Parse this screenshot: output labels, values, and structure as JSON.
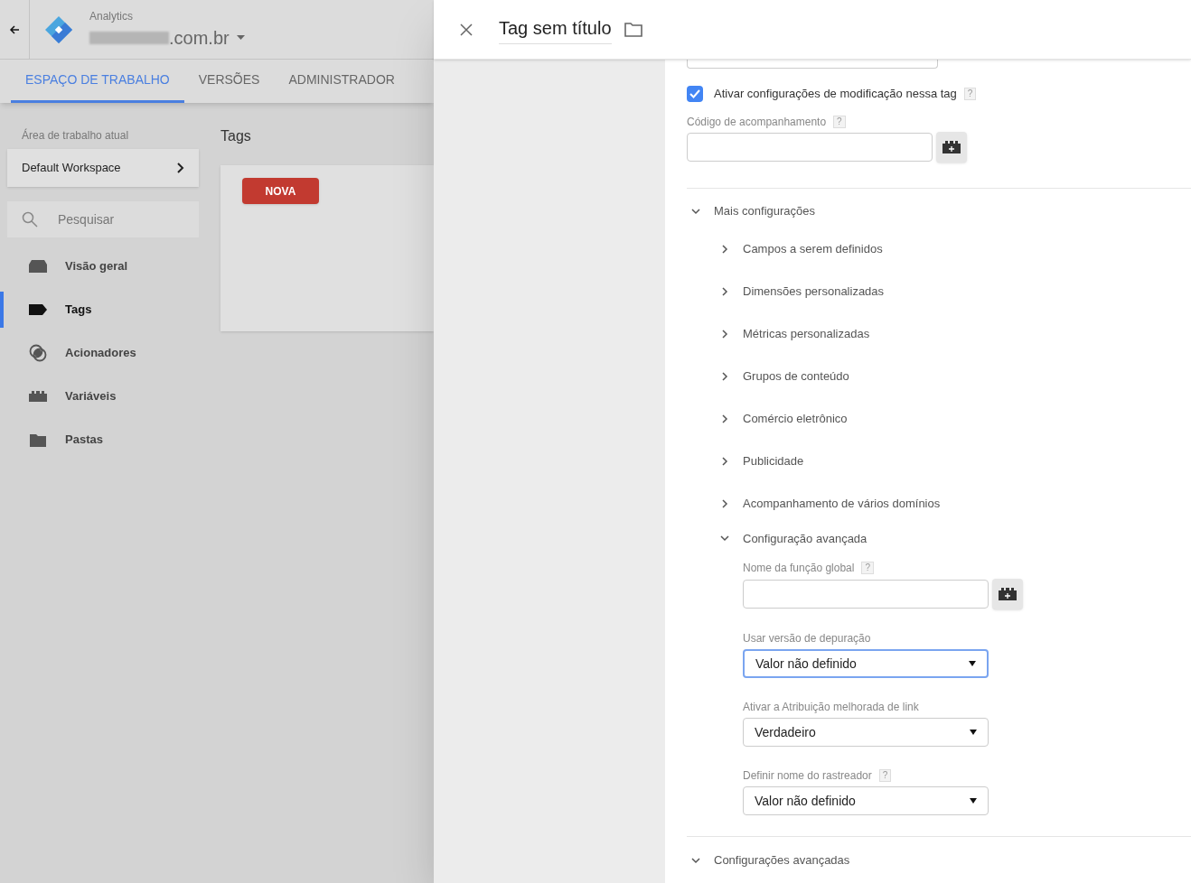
{
  "header": {
    "product": "Analytics",
    "account": ".com.br"
  },
  "tabs": [
    {
      "label": "ESPAÇO DE TRABALHO",
      "selected": true
    },
    {
      "label": "VERSÕES",
      "selected": false
    },
    {
      "label": "ADMINISTRADOR",
      "selected": false
    }
  ],
  "sidebar": {
    "workspace_label": "Área de trabalho atual",
    "workspace": "Default Workspace",
    "search_placeholder": "Pesquisar",
    "items": [
      {
        "label": "Visão geral",
        "kind": "overview",
        "selected": false
      },
      {
        "label": "Tags",
        "kind": "tag",
        "selected": true
      },
      {
        "label": "Acionadores",
        "kind": "trigger",
        "selected": false
      },
      {
        "label": "Variáveis",
        "kind": "variable",
        "selected": false
      },
      {
        "label": "Pastas",
        "kind": "folder",
        "selected": false
      }
    ]
  },
  "main": {
    "title": "Tags",
    "button": "NOVA"
  },
  "panel": {
    "title": "Tag sem título",
    "checkbox": {
      "label": "Ativar configurações de modificação nessa tag",
      "checked": true,
      "help": "?"
    },
    "tracking": {
      "label": "Código de acompanhamento",
      "help": "?"
    },
    "more": {
      "label": "Mais configurações",
      "expanded": true,
      "children": [
        {
          "label": "Campos a serem definidos",
          "expanded": false
        },
        {
          "label": "Dimensões personalizadas",
          "expanded": false
        },
        {
          "label": "Métricas personalizadas",
          "expanded": false
        },
        {
          "label": "Grupos de conteúdo",
          "expanded": false
        },
        {
          "label": "Comércio eletrônico",
          "expanded": false
        },
        {
          "label": "Publicidade",
          "expanded": false
        },
        {
          "label": "Acompanhamento de vários domínios",
          "expanded": false
        },
        {
          "label": "Configuração avançada",
          "expanded": true,
          "fields": [
            {
              "kind": "text",
              "label": "Nome da função global",
              "help": "?"
            },
            {
              "kind": "select",
              "label": "Usar versão de depuração",
              "value": "Valor não definido",
              "focused": true
            },
            {
              "kind": "select",
              "label": "Ativar a Atribuição melhorada de link",
              "value": "Verdadeiro",
              "focused": false
            },
            {
              "kind": "select",
              "label": "Definir nome do rastreador",
              "help": "?",
              "value": "Valor não definido",
              "focused": false
            }
          ]
        }
      ]
    },
    "advanced": {
      "label": "Configurações avançadas",
      "expanded": true
    }
  }
}
